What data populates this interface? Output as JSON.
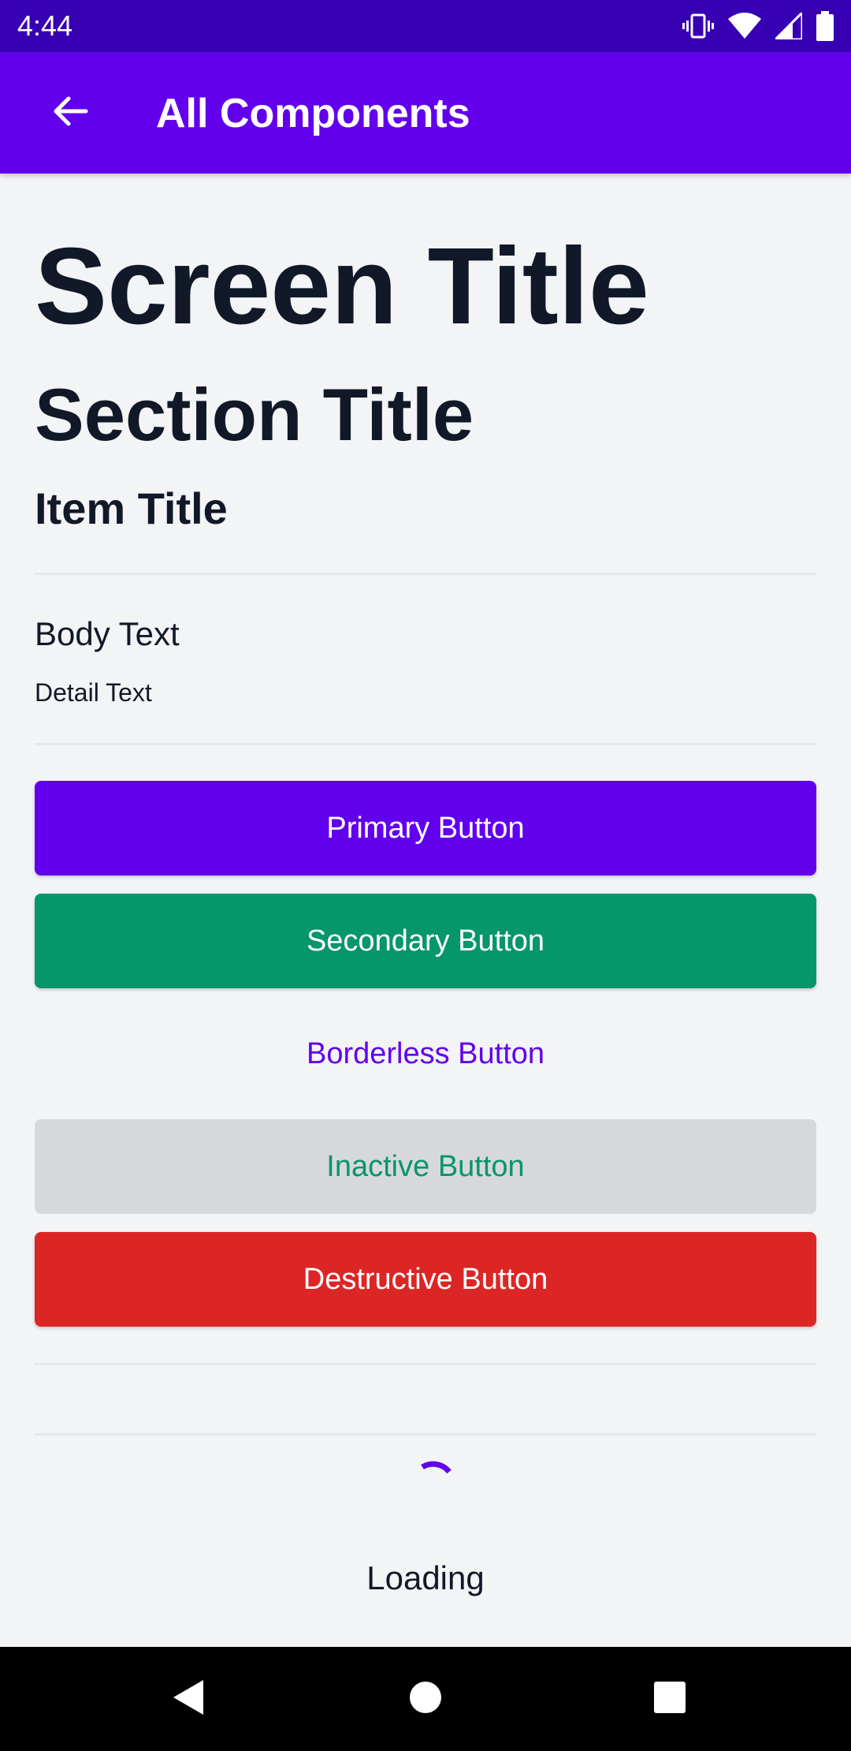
{
  "status_bar": {
    "time": "4:44",
    "icons": [
      "vibrate-icon",
      "wifi-icon",
      "signal-icon",
      "battery-icon"
    ]
  },
  "app_bar": {
    "title": "All Components",
    "back_icon": "arrow-back-icon",
    "background_color": "#6200ee"
  },
  "typography": {
    "screen_title": "Screen Title",
    "section_title": "Section Title",
    "item_title": "Item Title",
    "body_text": "Body Text",
    "detail_text": "Detail Text"
  },
  "buttons": {
    "primary": "Primary Button",
    "secondary": "Secondary Button",
    "borderless": "Borderless Button",
    "inactive": "Inactive Button",
    "destructive": "Destructive Button"
  },
  "loading": {
    "label": "Loading"
  },
  "colors": {
    "primary": "#6200ee",
    "secondary": "#059669",
    "destructive": "#dc2626",
    "inactive_bg": "#d7d8dc",
    "text": "#111827",
    "background": "#f3f4f6"
  },
  "nav_bar": {
    "icons": [
      "back-triangle-icon",
      "home-circle-icon",
      "recents-square-icon"
    ]
  }
}
